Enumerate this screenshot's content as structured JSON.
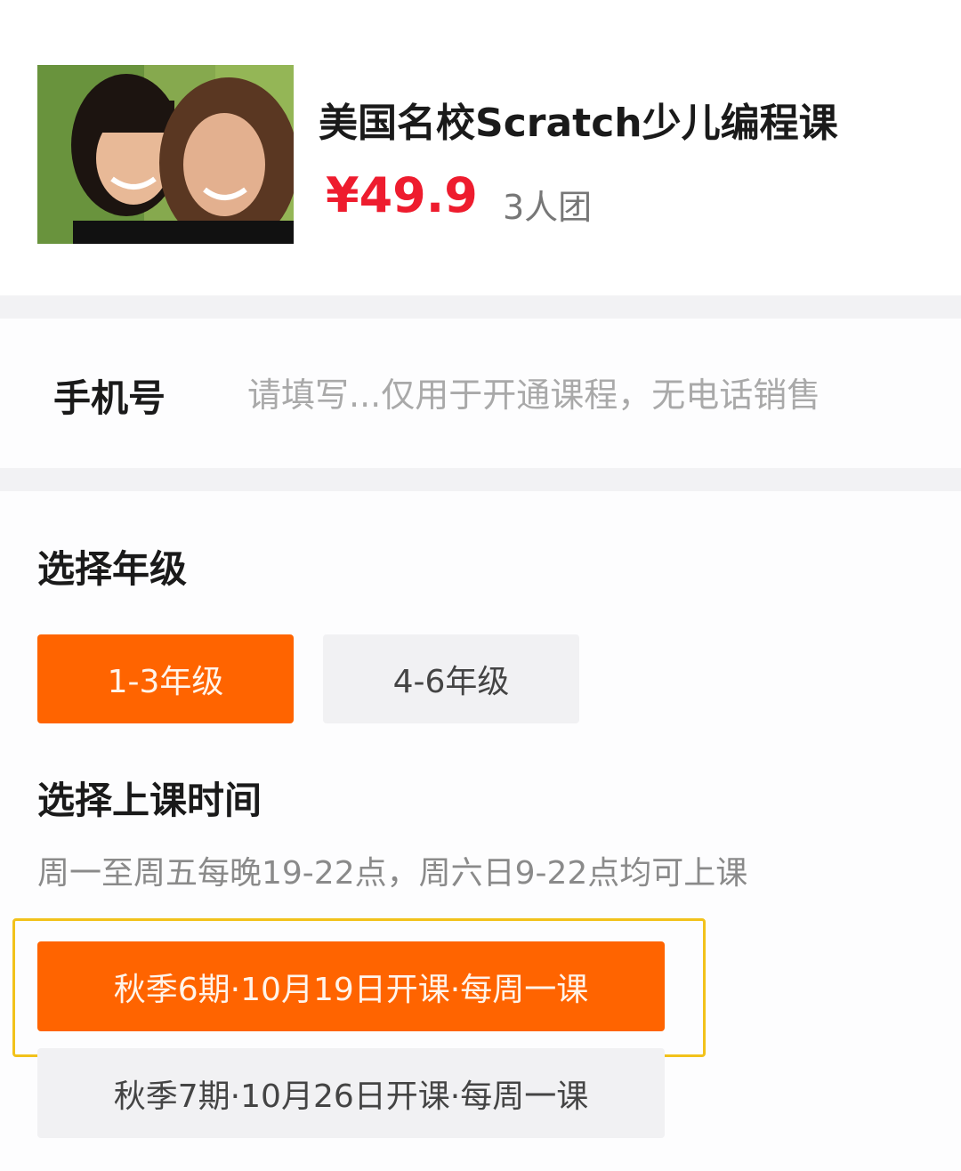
{
  "product": {
    "title": "美国名校Scratch少儿编程课",
    "price": "¥49.9",
    "group_label": "3人团",
    "image_alt": "mother-and-daughter-photo"
  },
  "phone": {
    "label": "手机号",
    "placeholder": "请填写...仅用于开通课程，无电话销售",
    "value": ""
  },
  "grade": {
    "title": "选择年级",
    "options": [
      {
        "label": "1-3年级",
        "selected": true
      },
      {
        "label": "4-6年级",
        "selected": false
      }
    ]
  },
  "schedule": {
    "title": "选择上课时间",
    "note": "周一至周五每晚19-22点，周六日9-22点均可上课",
    "options": [
      {
        "label": "秋季6期·10月19日开课·每周一课",
        "selected": true
      },
      {
        "label": "秋季7期·10月26日开课·每周一课",
        "selected": false
      }
    ]
  },
  "colors": {
    "accent": "#ff6400",
    "price": "#ee1c2e",
    "highlight_border": "#f2c21b",
    "inactive_bg": "#f1f1f3"
  }
}
